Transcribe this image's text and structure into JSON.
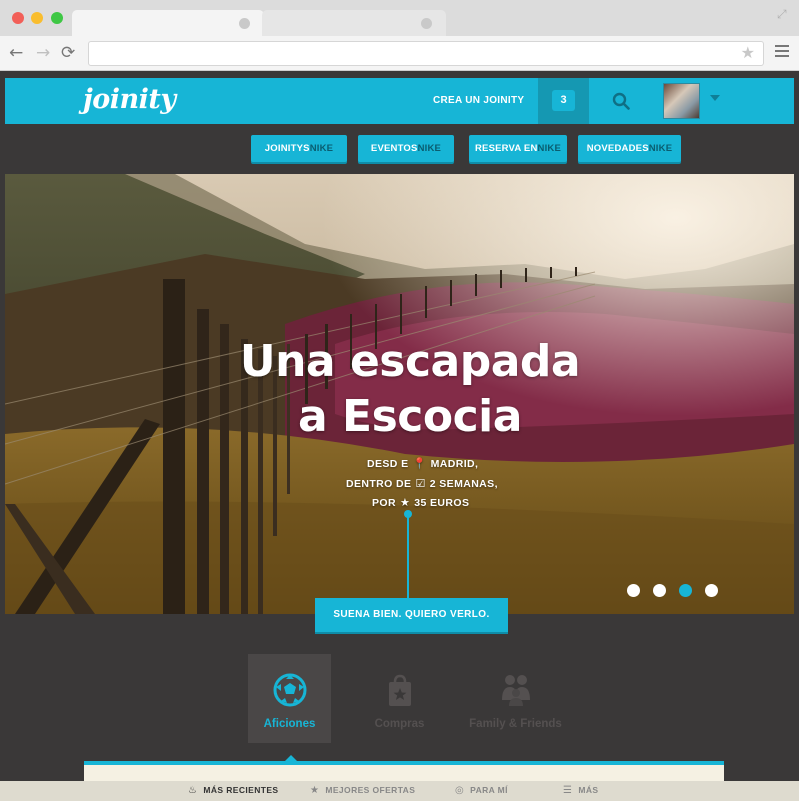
{
  "browser": {
    "back_glyph": "←",
    "forward_glyph": "→",
    "reload_glyph": "⟳",
    "url": "",
    "bookmark_glyph": "★",
    "expand_glyph": "⤢"
  },
  "header": {
    "logo": "joinity",
    "crea_label": "CREA UN JOINITY",
    "notification_count": "3",
    "search_icon": "search-icon",
    "avatar_icon": "user-avatar"
  },
  "categories": [
    {
      "label": "JOINITYS",
      "suffix": "NIKE"
    },
    {
      "label": "EVENTOS",
      "suffix": "NIKE"
    },
    {
      "label": "RESERVA EN",
      "suffix": "NIKE"
    },
    {
      "label": "NOVEDADES",
      "suffix": "NIKE"
    }
  ],
  "hero": {
    "title_line1": "Una escapada",
    "title_line2": "a Escocia",
    "line1_prefix": "DESD E",
    "line1_value": "MADRID,",
    "line2_prefix": "DENTRO DE",
    "line2_value": "2 SEMANAS,",
    "line3_prefix": "POR",
    "line3_value": "35 EUROS",
    "cta": "SUENA BIEN. QUIERO VERLO.",
    "slides_total": 4,
    "active_slide": 3
  },
  "tabs": [
    {
      "label": "Aficiones",
      "icon": "soccer-ball-icon",
      "active": true
    },
    {
      "label": "Compras",
      "icon": "shopping-bag-icon",
      "active": false
    },
    {
      "label": "Family & Friends",
      "icon": "people-icon",
      "active": false
    }
  ],
  "filters": [
    {
      "label": "MÁS RECIENTES",
      "icon": "fire-icon",
      "glyph": "♨"
    },
    {
      "label": "MEJORES OFERTAS",
      "icon": "star-icon",
      "glyph": "★"
    },
    {
      "label": "PARA MÍ",
      "icon": "target-icon",
      "glyph": "◎"
    },
    {
      "label": "MÁS",
      "icon": "list-icon",
      "glyph": "☰"
    }
  ],
  "colors": {
    "accent": "#17b5d6",
    "accent_dark": "#1598b2",
    "page_bg": "#3a3838",
    "panel_bg": "#f5f1e3"
  }
}
